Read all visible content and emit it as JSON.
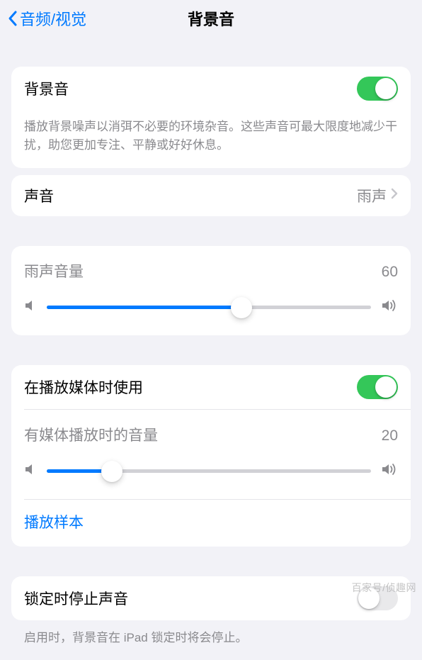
{
  "nav": {
    "back_label": "音频/视觉",
    "title": "背景音"
  },
  "main_toggle": {
    "label": "背景音",
    "enabled": true,
    "description": "播放背景噪声以消弭不必要的环境杂音。这些声音可最大限度地减少干扰，助您更加专注、平静或好好休息。"
  },
  "sound_row": {
    "label": "声音",
    "value": "雨声"
  },
  "volume1": {
    "label": "雨声音量",
    "value": 60
  },
  "media_section": {
    "toggle_label": "在播放媒体时使用",
    "toggle_enabled": true,
    "volume_label": "有媒体播放时的音量",
    "volume_value": 20,
    "sample_link": "播放样本"
  },
  "lock_section": {
    "label": "锁定时停止声音",
    "enabled": false,
    "description": "启用时，背景音在 iPad 锁定时将会停止。"
  },
  "watermark": "百家号/侦趣网"
}
